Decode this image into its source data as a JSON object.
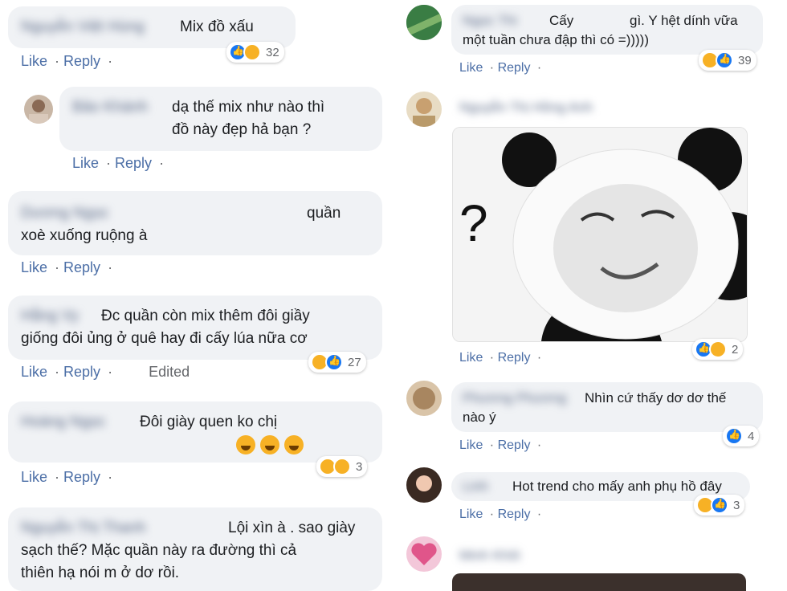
{
  "actions": {
    "like": "Like",
    "reply": "Reply",
    "edited": "Edited"
  },
  "left": {
    "c1": {
      "name": "Nguyễn Việt Hùng",
      "text": "Mix đồ xấu",
      "count": "32"
    },
    "c2": {
      "name": "Bảo Khánh",
      "line1": "dạ thế mix như nào thì",
      "line2": "đồ này đẹp hả bạn ?"
    },
    "c3": {
      "name": "Dương Ngọc",
      "line1": "quần",
      "line2": "xoè xuống ruộng à"
    },
    "c4": {
      "name": "Hằng Vy",
      "line1": "Đc quần còn mix thêm đôi giầy",
      "line2": "giống đôi ủng ở quê hay đi cấy lúa nữa cơ",
      "count": "27"
    },
    "c5": {
      "name": "Hoàng Ngọc",
      "line1": "Đôi giày quen ko chị",
      "count": "3"
    },
    "c6": {
      "name": "Nguyễn Thị Thanh",
      "line1": "Lội xìn à . sao giày",
      "line2": "sạch thế? Mặc quần này ra đường thì cả",
      "line3": "thiên hạ nói m ở dơ rồi."
    }
  },
  "right": {
    "c1": {
      "name": "Ngọc Thi",
      "line1a": "Cấy",
      "line1b": "gì. Y hệt dính vữa",
      "line2": "một tuần chưa đập thì có =)))))",
      "count": "39"
    },
    "c2": {
      "name": "Nguyễn Thị Hồng Anh",
      "count": "2",
      "meme_q": "?"
    },
    "c3": {
      "name": "Phương Phương",
      "line1": "Nhìn cứ thấy dơ dơ thế",
      "line2": "nào ý",
      "count": "4"
    },
    "c4": {
      "name": "Linh",
      "line1": "Hot trend cho mấy anh phụ hồ đây",
      "count": "3"
    },
    "c5": {
      "name": "Minh Khôi"
    }
  },
  "colors": {
    "bubble": "#f0f2f5",
    "link": "#4b6ea6",
    "like_blue": "#1877f2",
    "haha_yellow": "#f7b125"
  }
}
